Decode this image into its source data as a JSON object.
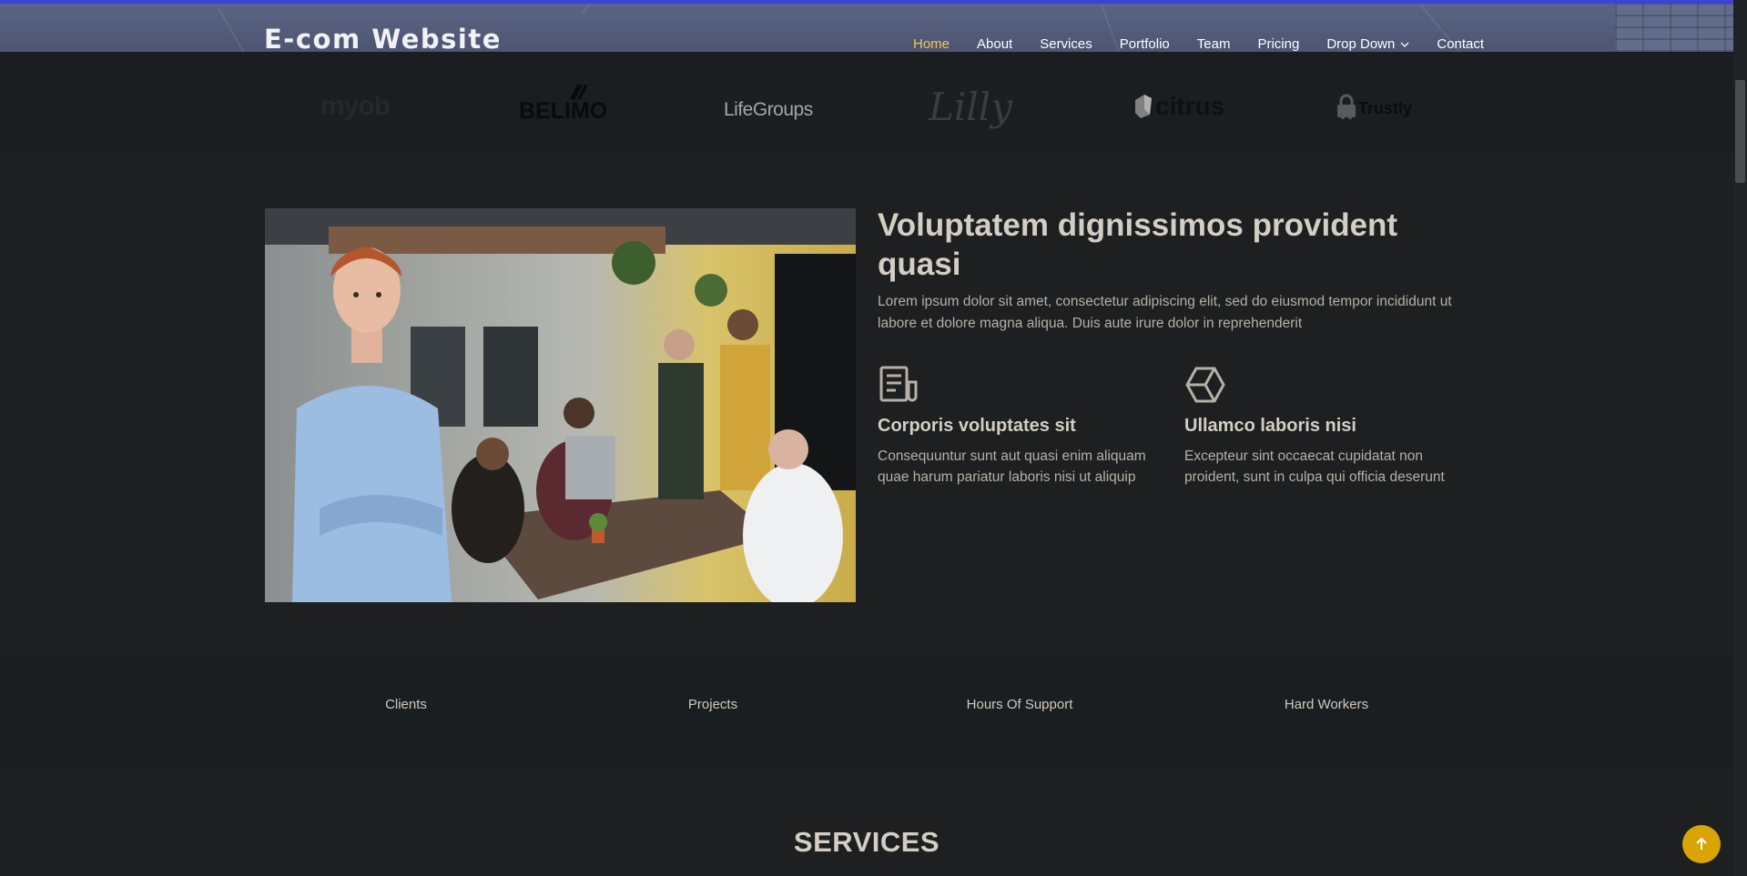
{
  "header": {
    "logo": "E-com Website",
    "nav": [
      {
        "label": "Home",
        "active": true
      },
      {
        "label": "About"
      },
      {
        "label": "Services"
      },
      {
        "label": "Portfolio"
      },
      {
        "label": "Team"
      },
      {
        "label": "Pricing"
      },
      {
        "label": "Drop Down",
        "has_dropdown": true
      },
      {
        "label": "Contact"
      }
    ],
    "accent_color": "#f2c84b"
  },
  "clients": [
    {
      "name": "myob"
    },
    {
      "name": "BELIMO"
    },
    {
      "name": "LifeGroups"
    },
    {
      "name": "Lilly"
    },
    {
      "name": "citrus"
    },
    {
      "name": "Trustly"
    }
  ],
  "about": {
    "title": "Voluptatem dignissimos provident quasi",
    "text": "Lorem ipsum dolor sit amet, consectetur adipiscing elit, sed do eiusmod tempor incididunt ut labore et dolore magna aliqua. Duis aute irure dolor in reprehenderit",
    "features": [
      {
        "icon": "newspaper-icon",
        "title": "Corporis voluptates sit",
        "text": "Consequuntur sunt aut quasi enim aliquam quae harum pariatur laboris nisi ut aliquip"
      },
      {
        "icon": "cube-icon",
        "title": "Ullamco laboris nisi",
        "text": "Excepteur sint occaecat cupidatat non proident, sunt in culpa qui officia deserunt"
      }
    ]
  },
  "counts": [
    {
      "label": "Clients"
    },
    {
      "label": "Projects"
    },
    {
      "label": "Hours Of Support"
    },
    {
      "label": "Hard Workers"
    }
  ],
  "services": {
    "title": "SERVICES"
  },
  "back_to_top": {
    "icon": "arrow-up-icon",
    "color": "#d9a406"
  }
}
